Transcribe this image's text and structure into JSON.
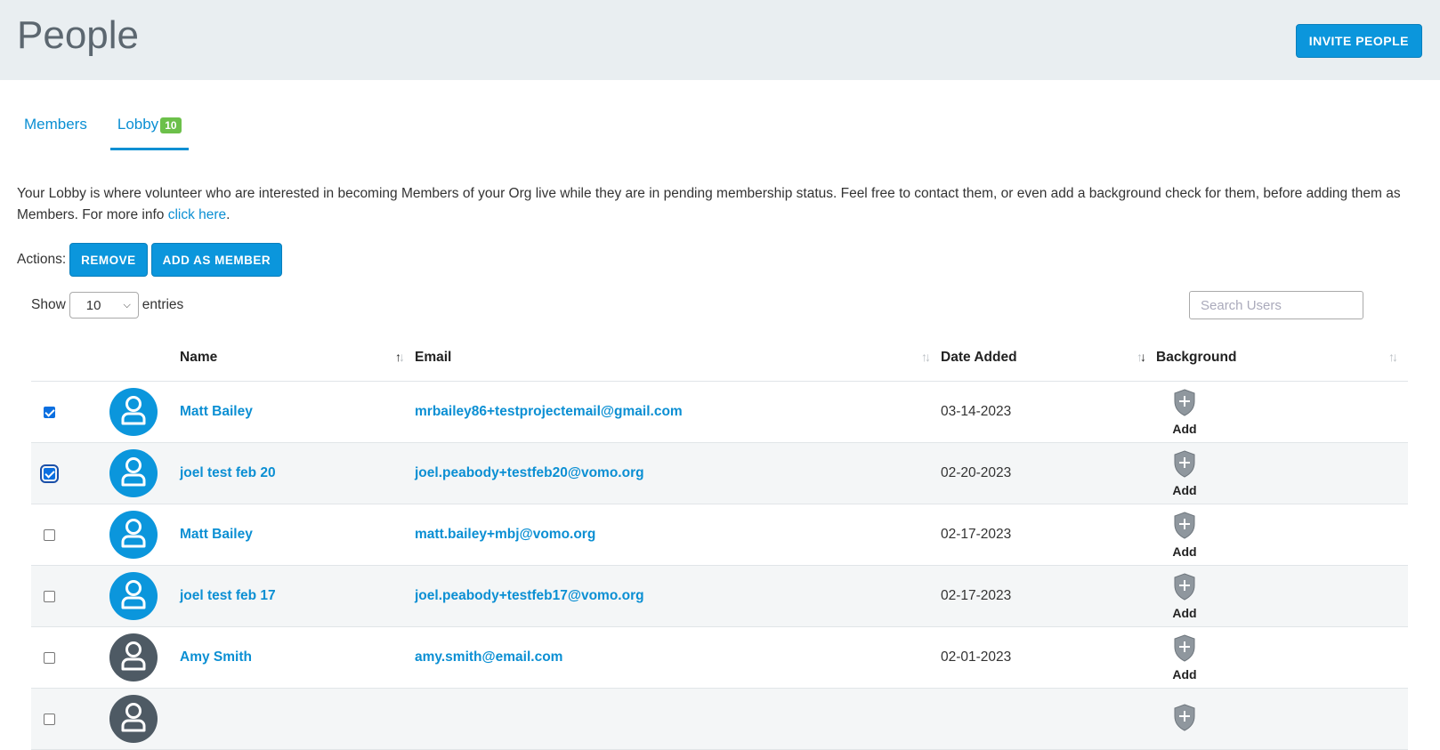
{
  "header": {
    "title": "People",
    "invite_label": "INVITE PEOPLE"
  },
  "tabs": [
    {
      "label": "Members",
      "active": false
    },
    {
      "label": "Lobby",
      "active": true,
      "badge": "10"
    }
  ],
  "intro": {
    "text": "Your Lobby is where volunteer who are interested in becoming Members of your Org live while they are in pending membership status. Feel free to contact them, or even add a background check for them, before adding them as Members. For more info ",
    "link_text": "click here",
    "suffix": "."
  },
  "actions": {
    "label": "Actions:",
    "remove_label": "REMOVE",
    "add_member_label": "ADD AS MEMBER"
  },
  "length_menu": {
    "show_label": "Show",
    "selected": "10",
    "entries_label": "entries"
  },
  "search": {
    "placeholder": "Search Users",
    "value": ""
  },
  "table": {
    "columns": [
      "Name",
      "Email",
      "Date Added",
      "Background"
    ],
    "sort": {
      "Name": "asc",
      "Email": "none",
      "Date Added": "desc",
      "Background": "none"
    },
    "rows": [
      {
        "checked": true,
        "avatar": "blue",
        "name": "Matt Bailey",
        "email": "mrbailey86+testprojectemail@gmail.com",
        "date_added": "03-14-2023",
        "background": "Add"
      },
      {
        "checked": true,
        "avatar": "blue",
        "name": "joel test feb 20",
        "email": "joel.peabody+testfeb20@vomo.org",
        "date_added": "02-20-2023",
        "background": "Add"
      },
      {
        "checked": false,
        "avatar": "blue",
        "name": "Matt Bailey",
        "email": "matt.bailey+mbj@vomo.org",
        "date_added": "02-17-2023",
        "background": "Add"
      },
      {
        "checked": false,
        "avatar": "blue",
        "name": "joel test feb 17",
        "email": "joel.peabody+testfeb17@vomo.org",
        "date_added": "02-17-2023",
        "background": "Add"
      },
      {
        "checked": false,
        "avatar": "gray",
        "name": "Amy Smith",
        "email": "amy.smith@email.com",
        "date_added": "02-01-2023",
        "background": "Add"
      },
      {
        "checked": false,
        "avatar": "gray",
        "name": "",
        "email": "",
        "date_added": "",
        "background": ""
      }
    ]
  },
  "colors": {
    "accent": "#0b96dc",
    "badge": "#6cc04a",
    "header_bg": "#e9eef1",
    "avatar_gray": "#4e5a64"
  }
}
